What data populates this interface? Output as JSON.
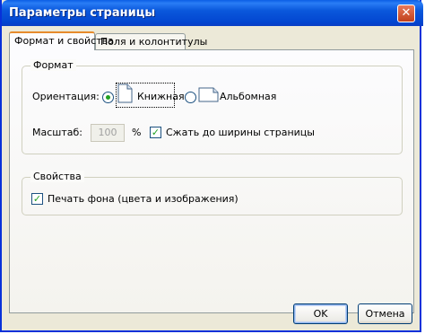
{
  "window": {
    "title": "Параметры страницы",
    "close_glyph": "✕"
  },
  "tabs": [
    {
      "label": "Формат и свойства",
      "active": true
    },
    {
      "label": "Поля и колонтитулы",
      "active": false
    }
  ],
  "format_group": {
    "legend": "Формат",
    "orientation_label": "Ориентация:",
    "portrait_label": "Книжная",
    "landscape_label": "Альбомная",
    "portrait_selected": true,
    "scale_label": "Масштаб:",
    "scale_value": "100",
    "scale_unit": "%",
    "shrink_to_fit_label": "Сжать до ширины страницы",
    "shrink_to_fit_checked": true
  },
  "properties_group": {
    "legend": "Свойства",
    "print_background_label": "Печать фона (цвета и изображения)",
    "print_background_checked": true
  },
  "buttons": {
    "ok_label": "OK",
    "cancel_label": "Отмена"
  },
  "icons": {
    "close": "close-icon",
    "portrait": "portrait-page-icon",
    "landscape": "landscape-page-icon",
    "check": "checkmark-icon"
  },
  "colors": {
    "titlebar": "#0a58dc",
    "accent_check": "#21a121",
    "tab_highlight": "#e68b2c"
  }
}
